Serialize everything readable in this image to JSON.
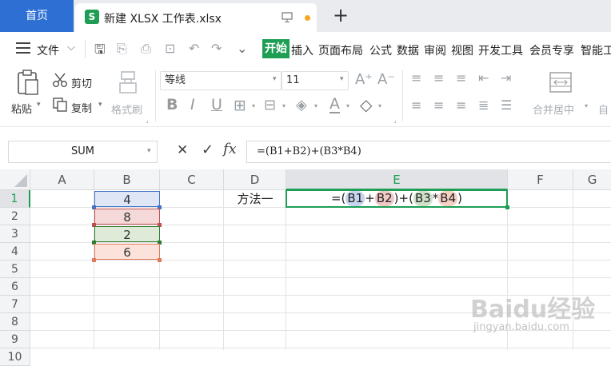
{
  "tabs": {
    "home": "首页",
    "document": "新建 XLSX 工作表.xlsx",
    "xls_icon": "S",
    "new_tab": "+"
  },
  "menu": {
    "file": "文件",
    "items": [
      "开始",
      "插入",
      "页面布局",
      "公式",
      "数据",
      "审阅",
      "视图",
      "开发工具",
      "会员专享",
      "智能工"
    ]
  },
  "ribbon": {
    "paste": "粘贴",
    "cut": "剪切",
    "copy": "复制",
    "format_painter": "格式刷",
    "font_name": "等线",
    "font_size": "11",
    "merge_center": "合并居中",
    "auto": "自"
  },
  "formula_bar": {
    "name_box": "SUM",
    "cancel": "✕",
    "confirm": "✓",
    "fx": "fx",
    "formula": "=(B1+B2)+(B3*B4)"
  },
  "grid": {
    "columns": [
      "A",
      "B",
      "C",
      "D",
      "E",
      "F",
      "G"
    ],
    "rows": [
      "1",
      "2",
      "3",
      "4",
      "5",
      "6",
      "7",
      "8",
      "9",
      "10"
    ],
    "b_values": [
      "4",
      "8",
      "2",
      "6"
    ],
    "d1": "方法一",
    "e1": {
      "p1": "=(",
      "r1": "B1",
      "op1": "+",
      "r2": "B2",
      "p2": ")+(",
      "r3": "B3",
      "op2": "*",
      "r4": "B4",
      "p3": ")"
    }
  },
  "colors": {
    "accent": "#1e9e55",
    "home_tab": "#2d6fd2",
    "b1": "#4472c4",
    "b2": "#c0504d",
    "b3": "#2e7d32",
    "b4": "#e07a5f"
  },
  "watermark": {
    "brand": "Baidu经验",
    "url": "jingyan.baidu.com"
  }
}
